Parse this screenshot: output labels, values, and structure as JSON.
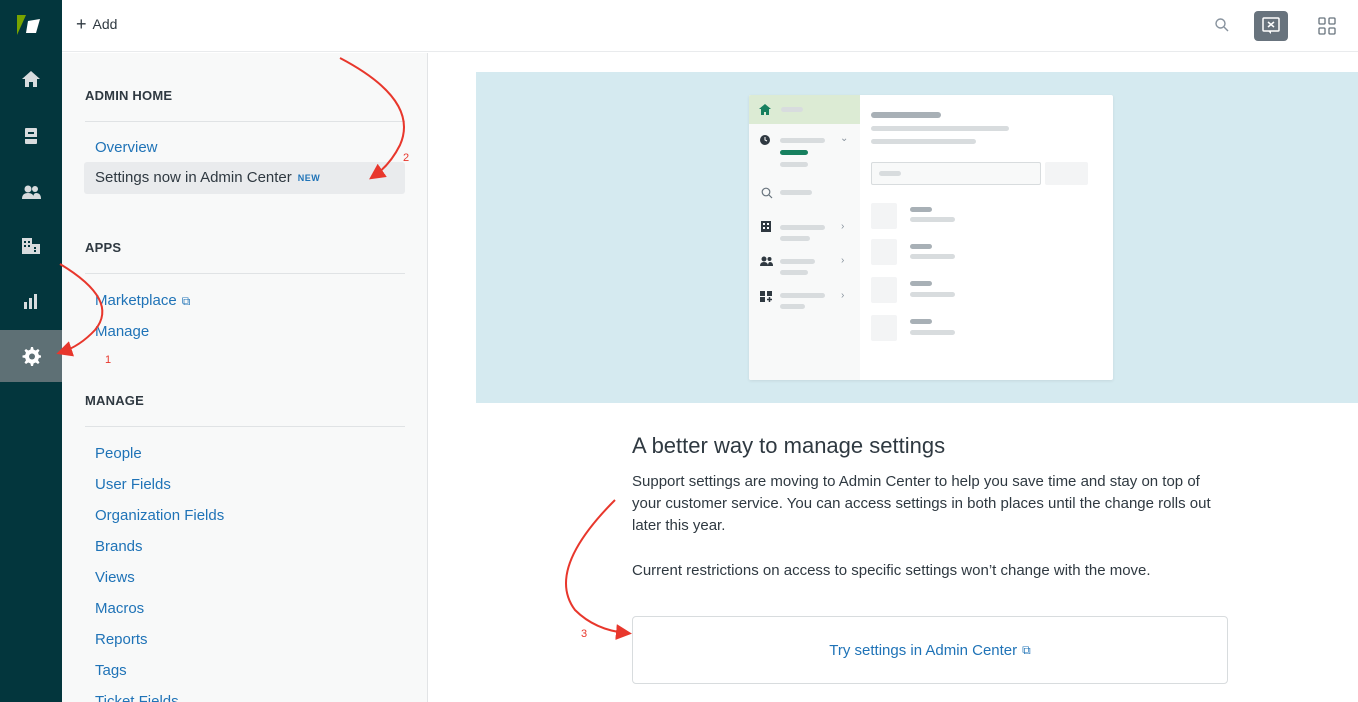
{
  "topbar": {
    "add_label": "Add",
    "icons": [
      "search-icon",
      "product-tray-icon",
      "apps-grid-icon"
    ]
  },
  "rail": {
    "items": [
      "home-icon",
      "views-icon",
      "customers-icon",
      "organizations-icon",
      "reporting-icon",
      "admin-gear-icon"
    ],
    "active": "admin-gear-icon"
  },
  "sidebar": {
    "admin_home": {
      "title": "ADMIN HOME",
      "items": [
        "Overview"
      ],
      "selected": {
        "label": "Settings now in Admin Center",
        "badge": "NEW"
      }
    },
    "apps": {
      "title": "APPS",
      "items": [
        "Marketplace",
        "Manage"
      ]
    },
    "manage": {
      "title": "MANAGE",
      "items": [
        "People",
        "User Fields",
        "Organization Fields",
        "Brands",
        "Views",
        "Macros",
        "Reports",
        "Tags",
        "Ticket Fields"
      ]
    }
  },
  "main": {
    "heading": "A better way to manage settings",
    "paragraph1": "Support settings are moving to Admin Center to help you save time and stay on top of your customer service. You can access settings in both places until the change rolls out later this year.",
    "paragraph2": "Current restrictions on access to specific settings won’t change with the move.",
    "cta_label": "Try settings in Admin Center"
  },
  "annotations": [
    "1",
    "2",
    "3"
  ],
  "colors": {
    "rail": "#03363d",
    "link": "#1f73b7",
    "hero": "#d5eaf0",
    "annotation": "#e8372c"
  }
}
